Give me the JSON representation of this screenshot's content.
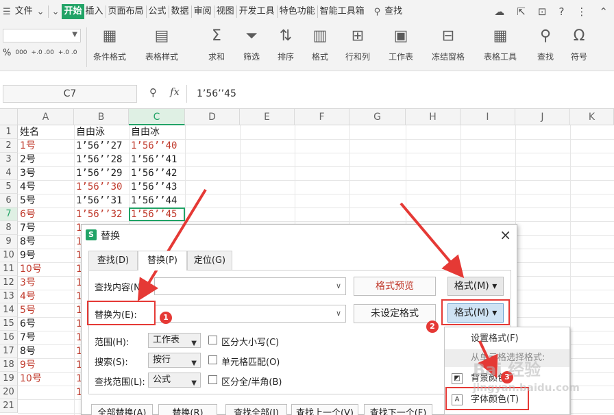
{
  "menubar": {
    "file": "文件",
    "tabs": [
      "开始",
      "插入",
      "页面布局",
      "公式",
      "数据",
      "审阅",
      "视图",
      "开发工具",
      "特色功能",
      "智能工具箱"
    ],
    "search": "查找"
  },
  "ribbon": {
    "num_percent": "%",
    "num_thousands": "000",
    "num_inc": "+.0 .00",
    "num_dec": "+.0 .0",
    "buttons": [
      "条件格式",
      "表格样式",
      "求和",
      "筛选",
      "排序",
      "格式",
      "行和列",
      "工作表",
      "冻结窗格",
      "表格工具",
      "查找",
      "符号"
    ]
  },
  "formula_bar": {
    "name_box": "C7",
    "fx": "fx",
    "value": "1’56’’45"
  },
  "sheet": {
    "columns": [
      "A",
      "B",
      "C",
      "D",
      "E",
      "F",
      "G",
      "H",
      "I",
      "J",
      "K"
    ],
    "rows": [
      "1",
      "2",
      "3",
      "4",
      "5",
      "6",
      "7",
      "8",
      "9",
      "10",
      "11",
      "12",
      "13",
      "14",
      "15",
      "16",
      "17",
      "18",
      "19",
      "20",
      "21"
    ],
    "header": [
      "姓名",
      "自由泳",
      "自由冰"
    ],
    "data": [
      {
        "a": "1号",
        "b": "1’56’’27",
        "c": "1’56’’40"
      },
      {
        "a": "2号",
        "b": "1’56’’28",
        "c": "1’56’’41"
      },
      {
        "a": "3号",
        "b": "1’56’’29",
        "c": "1’56’’42"
      },
      {
        "a": "4号",
        "b": "1’56’’30",
        "c": "1’56’’43"
      },
      {
        "a": "5号",
        "b": "1’56’’31",
        "c": "1’56’’44"
      },
      {
        "a": "6号",
        "b": "1’56’’32",
        "c": "1’56’’45"
      },
      {
        "a": "7号",
        "b": "1",
        "c": ""
      },
      {
        "a": "8号",
        "b": "1",
        "c": ""
      },
      {
        "a": "9号",
        "b": "1",
        "c": ""
      },
      {
        "a": "10号",
        "b": "1",
        "c": ""
      },
      {
        "a": "3号",
        "b": "1",
        "c": ""
      },
      {
        "a": "4号",
        "b": "1",
        "c": ""
      },
      {
        "a": "5号",
        "b": "1",
        "c": ""
      },
      {
        "a": "6号",
        "b": "1",
        "c": ""
      },
      {
        "a": "7号",
        "b": "1",
        "c": ""
      },
      {
        "a": "8号",
        "b": "1",
        "c": ""
      },
      {
        "a": "9号",
        "b": "1",
        "c": ""
      },
      {
        "a": "10号",
        "b": "1",
        "c": ""
      },
      {
        "a": "",
        "b": "1",
        "c": ""
      },
      {
        "a": "",
        "b": "",
        "c": ""
      }
    ],
    "red_color": "#c0392b",
    "accent_color": "#21a366"
  },
  "dialog": {
    "title": "替换",
    "close": "×",
    "tabs": [
      "查找(D)",
      "替换(P)",
      "定位(G)"
    ],
    "find_label": "查找内容(N):",
    "replace_label": "替换为(E):",
    "preview_button": "格式预览",
    "unset_button": "未设定格式",
    "format_button": "格式(M)",
    "scope_label": "范围(H):",
    "scope_value": "工作表",
    "search_label": "搜索(S):",
    "search_value": "按行",
    "lookin_label": "查找范围(L):",
    "lookin_value": "公式",
    "opt_case": "区分大小写(C)",
    "opt_whole": "单元格匹配(O)",
    "opt_width": "区分全/半角(B)",
    "bottom_buttons": [
      "全部替换(A)",
      "替换(R)",
      "查找全部(I)",
      "查找上一个(V)",
      "查找下一个(F)"
    ]
  },
  "dropdown": {
    "items": [
      "设置格式(F)",
      "从单元格选择格式:",
      "背景颜色",
      "字体颜色(T)"
    ]
  },
  "annotations": {
    "badges": [
      "1",
      "2",
      "3"
    ]
  },
  "watermark": {
    "text": "Bai 经验",
    "url": "jingyan.baidu.com"
  }
}
